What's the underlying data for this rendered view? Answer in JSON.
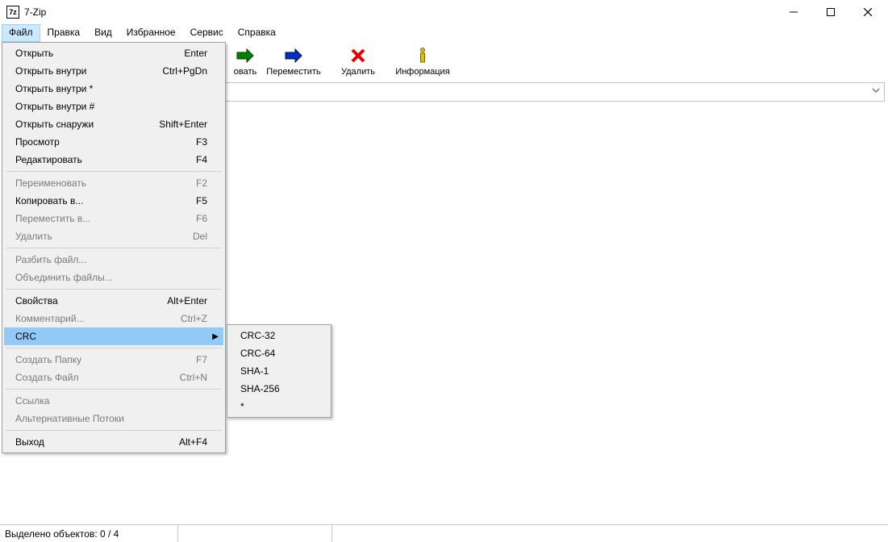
{
  "window": {
    "app_icon_text": "7z",
    "title": "7-Zip"
  },
  "menubar": {
    "items": [
      "Файл",
      "Правка",
      "Вид",
      "Избранное",
      "Сервис",
      "Справка"
    ],
    "active_index": 0
  },
  "toolbar": {
    "items": [
      {
        "name": "copy",
        "label": "овать"
      },
      {
        "name": "move",
        "label": "Переместить"
      },
      {
        "name": "delete",
        "label": "Удалить"
      },
      {
        "name": "info",
        "label": "Информация"
      }
    ]
  },
  "file_menu": {
    "groups": [
      [
        {
          "label": "Открыть",
          "shortcut": "Enter",
          "enabled": true
        },
        {
          "label": "Открыть внутри",
          "shortcut": "Ctrl+PgDn",
          "enabled": true
        },
        {
          "label": "Открыть внутри *",
          "shortcut": "",
          "enabled": true
        },
        {
          "label": "Открыть внутри #",
          "shortcut": "",
          "enabled": true
        },
        {
          "label": "Открыть снаружи",
          "shortcut": "Shift+Enter",
          "enabled": true
        },
        {
          "label": "Просмотр",
          "shortcut": "F3",
          "enabled": true
        },
        {
          "label": "Редактировать",
          "shortcut": "F4",
          "enabled": true
        }
      ],
      [
        {
          "label": "Переименовать",
          "shortcut": "F2",
          "enabled": false
        },
        {
          "label": "Копировать в...",
          "shortcut": "F5",
          "enabled": true
        },
        {
          "label": "Переместить в...",
          "shortcut": "F6",
          "enabled": false
        },
        {
          "label": "Удалить",
          "shortcut": "Del",
          "enabled": false
        }
      ],
      [
        {
          "label": "Разбить файл...",
          "shortcut": "",
          "enabled": false
        },
        {
          "label": "Объединить файлы...",
          "shortcut": "",
          "enabled": false
        }
      ],
      [
        {
          "label": "Свойства",
          "shortcut": "Alt+Enter",
          "enabled": true
        },
        {
          "label": "Комментарий...",
          "shortcut": "Ctrl+Z",
          "enabled": false
        },
        {
          "label": "CRC",
          "shortcut": "",
          "enabled": true,
          "submenu": true,
          "highlight": true
        }
      ],
      [
        {
          "label": "Создать Папку",
          "shortcut": "F7",
          "enabled": false
        },
        {
          "label": "Создать Файл",
          "shortcut": "Ctrl+N",
          "enabled": false
        }
      ],
      [
        {
          "label": "Ссылка",
          "shortcut": "",
          "enabled": false
        },
        {
          "label": "Альтернативные Потоки",
          "shortcut": "",
          "enabled": false
        }
      ],
      [
        {
          "label": "Выход",
          "shortcut": "Alt+F4",
          "enabled": true
        }
      ]
    ]
  },
  "crc_submenu": {
    "items": [
      "CRC-32",
      "CRC-64",
      "SHA-1",
      "SHA-256",
      "*"
    ]
  },
  "statusbar": {
    "text": "Выделено объектов: 0 / 4"
  }
}
